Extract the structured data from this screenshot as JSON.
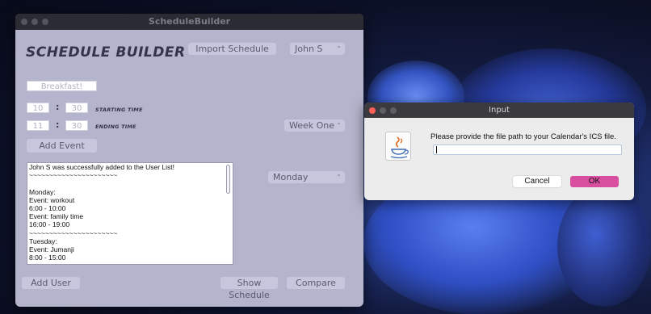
{
  "main_window": {
    "title": "ScheduleBuilder",
    "app_title": "SCHEDULE BUILDER",
    "import_button": "Import Schedule",
    "user_select": "John S",
    "event_name_field": "Breakfast!",
    "start_hour": "10",
    "start_minute": "30",
    "starting_time_label": "STARTING TIME",
    "end_hour": "11",
    "end_minute": "30",
    "ending_time_label": "ENDING TIME",
    "week_select": "Week One",
    "add_event_button": "Add Event",
    "day_select": "Monday",
    "log_lines": [
      "John S was successfully added to the User List!",
      "~~~~~~~~~~~~~~~~~~~~~~",
      "",
      "Monday:",
      "Event: workout",
      "6:00 - 10:00",
      "Event: family time",
      "16:00 - 19:00",
      "~~~~~~~~~~~~~~~~~~~~~~",
      "Tuesday:",
      "Event: Jumanji",
      "8:00 - 15:00",
      "~~~~~~~~~~~~~~~~~~~~~~"
    ],
    "add_user_button": "Add User",
    "show_schedule_button": "Show Schedule",
    "compare_button": "Compare"
  },
  "dialog": {
    "title": "Input",
    "message": "Please provide the file path to your Calendar's ICS file.",
    "input_value": "",
    "cancel_button": "Cancel",
    "ok_button": "OK"
  },
  "colors": {
    "window_bg": "#b4b4cc",
    "control_bg": "#c6c6dc",
    "ok_accent": "#d94fa0"
  }
}
